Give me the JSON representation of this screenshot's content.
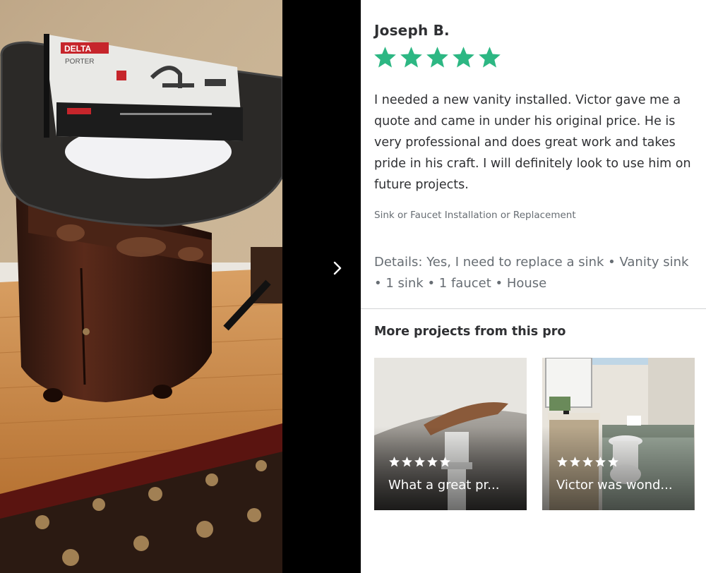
{
  "viewer": {
    "next_icon": "chevron-right-icon",
    "photo_label": "DELTA",
    "photo_sublabel": "PORTER"
  },
  "review": {
    "reviewer_name": "Joseph B.",
    "rating": 5,
    "star_color": "#2db783",
    "text": "I needed a new vanity installed. Victor gave me a quote and came in under his original price. He is very professional and does great work and takes pride in his craft. I will definitely look to use him on future projects.",
    "category": "Sink or Faucet Installation or Replacement",
    "details": "Details: Yes, I need to replace a sink • Vanity sink • 1 sink • 1 faucet • House"
  },
  "more_projects": {
    "title": "More projects from this pro",
    "items": [
      {
        "rating": 5,
        "snippet": "What a great pr..."
      },
      {
        "rating": 5,
        "snippet": "Victor was wond..."
      }
    ]
  }
}
